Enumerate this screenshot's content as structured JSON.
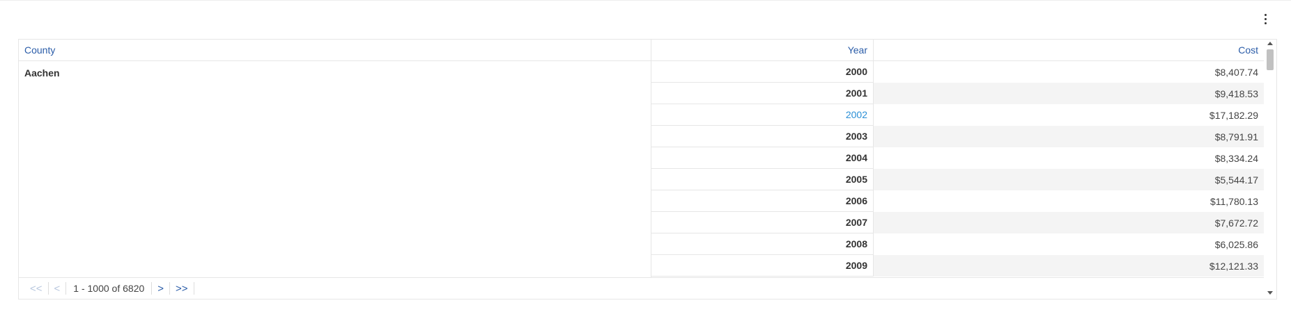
{
  "header": {
    "menu_icon": "more-vertical-icon"
  },
  "table": {
    "columns": {
      "county": "County",
      "year": "Year",
      "cost": "Cost"
    },
    "county_value": "Aachen",
    "rows": [
      {
        "year": "2000",
        "cost": "$8,407.74"
      },
      {
        "year": "2001",
        "cost": "$9,418.53"
      },
      {
        "year": "2002",
        "cost": "$17,182.29"
      },
      {
        "year": "2003",
        "cost": "$8,791.91"
      },
      {
        "year": "2004",
        "cost": "$8,334.24"
      },
      {
        "year": "2005",
        "cost": "$5,544.17"
      },
      {
        "year": "2006",
        "cost": "$11,780.13"
      },
      {
        "year": "2007",
        "cost": "$7,672.72"
      },
      {
        "year": "2008",
        "cost": "$6,025.86"
      },
      {
        "year": "2009",
        "cost": "$12,121.33"
      }
    ],
    "highlighted_year": "2002"
  },
  "pagination": {
    "first_label": "<<",
    "prev_label": "<",
    "range_text": "1 - 1000 of 6820",
    "next_label": ">",
    "last_label": ">>"
  },
  "colors": {
    "header_text": "#2a5ca8",
    "highlight_text": "#2a8fd6",
    "alt_row_bg": "#f4f4f4"
  }
}
